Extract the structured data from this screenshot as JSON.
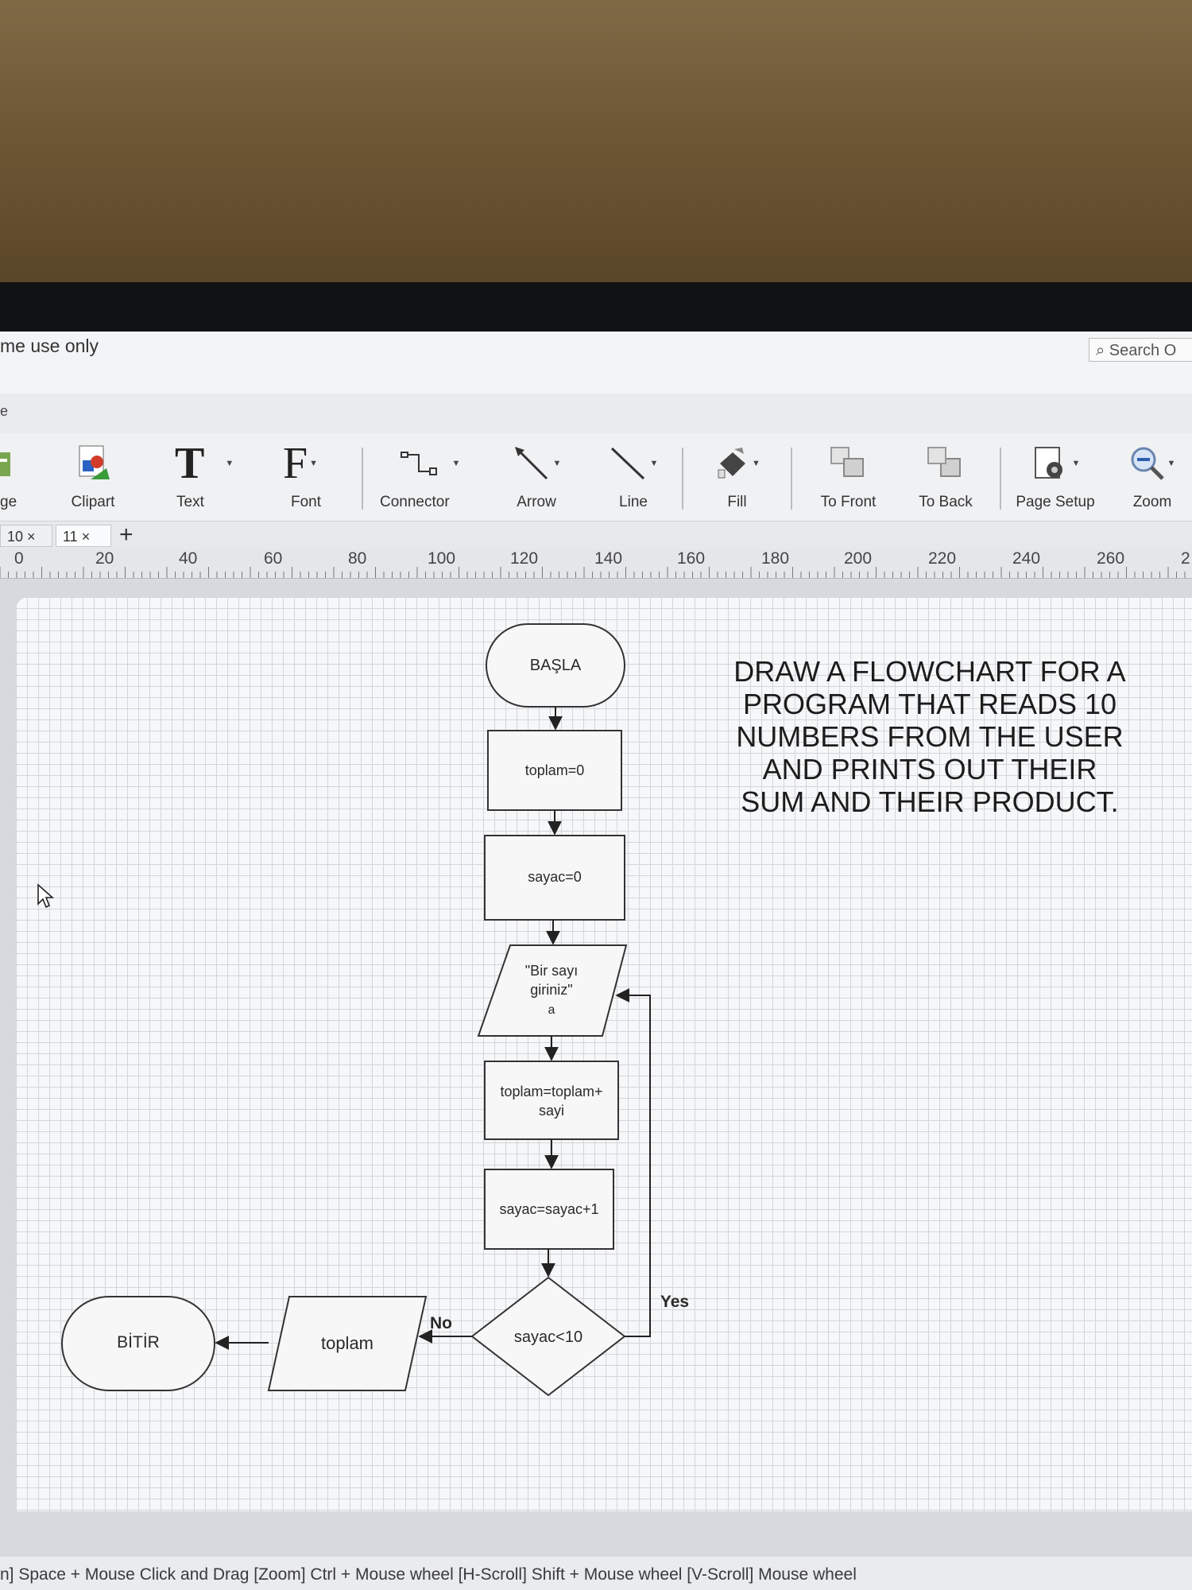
{
  "window": {
    "title_fragment": "me use only",
    "search_placeholder": "Search O",
    "menu_fragment": "e"
  },
  "ribbon": {
    "buttons": [
      {
        "id": "image",
        "label": "ge",
        "icon": "image-icon"
      },
      {
        "id": "clipart",
        "label": "Clipart",
        "icon": "clipart-icon"
      },
      {
        "id": "text",
        "label": "Text",
        "icon": "text-icon"
      },
      {
        "id": "font",
        "label": "Font",
        "icon": "font-icon"
      },
      {
        "id": "connector",
        "label": "Connector",
        "icon": "connector-icon"
      },
      {
        "id": "arrow",
        "label": "Arrow",
        "icon": "arrow-icon"
      },
      {
        "id": "line",
        "label": "Line",
        "icon": "line-icon"
      },
      {
        "id": "fill",
        "label": "Fill",
        "icon": "fill-bucket-icon"
      },
      {
        "id": "to_front",
        "label": "To Front",
        "icon": "to-front-icon"
      },
      {
        "id": "to_back",
        "label": "To Back",
        "icon": "to-back-icon"
      },
      {
        "id": "page_setup",
        "label": "Page Setup",
        "icon": "page-setup-icon"
      },
      {
        "id": "zoom",
        "label": "Zoom",
        "icon": "zoom-icon"
      }
    ]
  },
  "tabs": [
    {
      "label": "10",
      "close": "×"
    },
    {
      "label": "11",
      "close": "×"
    }
  ],
  "tab_add": "+",
  "ruler": {
    "ticks": [
      "0",
      "20",
      "40",
      "60",
      "80",
      "100",
      "120",
      "140",
      "160",
      "180",
      "200",
      "220",
      "240",
      "260",
      "2"
    ]
  },
  "flowchart": {
    "nodes": {
      "start": "BAŞLA",
      "init_sum": "toplam=0",
      "init_counter": "sayac=0",
      "input_line1": "\"Bir sayı",
      "input_line2": "giriniz\"",
      "input_line3": "a",
      "sum_line1": "toplam=toplam+",
      "sum_line2": "sayi",
      "increment": "sayac=sayac+1",
      "decision": "sayac<10",
      "output": "toplam",
      "end": "BİTİR"
    },
    "labels": {
      "yes": "Yes",
      "no": "No"
    }
  },
  "prompt_lines": [
    "DRAW A FLOWCHART FOR A",
    "PROGRAM THAT READS 10",
    "NUMBERS FROM THE USER",
    "AND PRINTS OUT THEIR",
    "SUM AND THEIR PRODUCT."
  ],
  "status": "n] Space + Mouse Click and Drag  [Zoom] Ctrl + Mouse wheel  [H-Scroll] Shift + Mouse wheel  [V-Scroll] Mouse wheel"
}
